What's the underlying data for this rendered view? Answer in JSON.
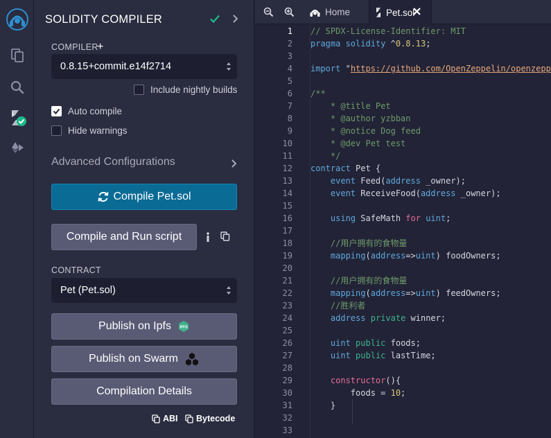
{
  "panel": {
    "title": "SOLIDITY COMPILER",
    "compiler_label": "COMPILER",
    "compiler_add": "+",
    "compiler_version": "0.8.15+commit.e14f2714",
    "include_nightly": "Include nightly builds",
    "auto_compile": "Auto compile",
    "hide_warnings": "Hide warnings",
    "advanced": "Advanced Configurations",
    "compile_button": "Compile Pet.sol",
    "compile_run_button": "Compile and Run script",
    "contract_label": "CONTRACT",
    "contract_value": "Pet (Pet.sol)",
    "publish_ipfs": "Publish on Ipfs",
    "ipfs_badge": "IPFS",
    "publish_swarm": "Publish on Swarm",
    "compilation_details": "Compilation Details",
    "abi": "ABI",
    "bytecode": "Bytecode",
    "checkbox_state": {
      "include_nightly": false,
      "auto_compile": true,
      "hide_warnings": false
    }
  },
  "icons": {
    "rail": [
      "remix-logo-icon",
      "file-explorer-icon",
      "search-icon",
      "solidity-compiler-icon",
      "deploy-run-icon"
    ],
    "accent": "#1bb98b",
    "primary_button": "#0a6b95"
  },
  "editor": {
    "tabs": [
      {
        "label": "Home",
        "icon": "home-icon"
      },
      {
        "label": "Pet.sol",
        "icon": "solidity-file-icon"
      }
    ],
    "active_line": 1,
    "lines": [
      [
        [
          "comment",
          "// SPDX-License-Identifier: MIT"
        ]
      ],
      [
        [
          "kw",
          "pragma solidity"
        ],
        [
          "plain",
          " ^"
        ],
        [
          "num",
          "0.8.13"
        ],
        [
          "plain",
          ";"
        ]
      ],
      [],
      [
        [
          "kw",
          "import"
        ],
        [
          "plain",
          " \""
        ],
        [
          "str",
          "https://github.com/OpenZeppelin/openzeppelin"
        ]
      ],
      [],
      [
        [
          "comment",
          "/**"
        ]
      ],
      [
        [
          "comment",
          "    * @title Pet"
        ]
      ],
      [
        [
          "comment",
          "    * @author yzbban"
        ]
      ],
      [
        [
          "comment",
          "    * @notice Dog feed"
        ]
      ],
      [
        [
          "comment",
          "    * @dev Pet test"
        ]
      ],
      [
        [
          "comment",
          "    */"
        ]
      ],
      [
        [
          "kw",
          "contract"
        ],
        [
          "plain",
          " Pet {"
        ]
      ],
      [
        [
          "plain",
          "    "
        ],
        [
          "kw",
          "event"
        ],
        [
          "plain",
          " Feed("
        ],
        [
          "kw",
          "address"
        ],
        [
          "plain",
          " _owner);"
        ]
      ],
      [
        [
          "plain",
          "    "
        ],
        [
          "kw",
          "event"
        ],
        [
          "plain",
          " ReceiveFood("
        ],
        [
          "kw",
          "address"
        ],
        [
          "plain",
          " _owner);"
        ]
      ],
      [],
      [
        [
          "plain",
          "    "
        ],
        [
          "kw",
          "using"
        ],
        [
          "plain",
          " SafeMath "
        ],
        [
          "ctor",
          "for"
        ],
        [
          "plain",
          " "
        ],
        [
          "kw",
          "uint"
        ],
        [
          "plain",
          ";"
        ]
      ],
      [],
      [
        [
          "comment",
          "    //用户拥有的食物量"
        ]
      ],
      [
        [
          "plain",
          "    "
        ],
        [
          "kw",
          "mapping"
        ],
        [
          "plain",
          "("
        ],
        [
          "kw",
          "address"
        ],
        [
          "plain",
          "=>"
        ],
        [
          "kw",
          "uint"
        ],
        [
          "plain",
          ") foodOwners;"
        ]
      ],
      [],
      [
        [
          "comment",
          "    //用户拥有的食物量"
        ]
      ],
      [
        [
          "plain",
          "    "
        ],
        [
          "kw",
          "mapping"
        ],
        [
          "plain",
          "("
        ],
        [
          "kw",
          "address"
        ],
        [
          "plain",
          "=>"
        ],
        [
          "kw",
          "uint"
        ],
        [
          "plain",
          ") feedOwners;"
        ]
      ],
      [
        [
          "comment",
          "    //胜利者"
        ]
      ],
      [
        [
          "plain",
          "    "
        ],
        [
          "kw",
          "address"
        ],
        [
          "plain",
          " "
        ],
        [
          "mod",
          "private"
        ],
        [
          "plain",
          " winner;"
        ]
      ],
      [],
      [
        [
          "plain",
          "    "
        ],
        [
          "kw",
          "uint"
        ],
        [
          "plain",
          " "
        ],
        [
          "mod",
          "public"
        ],
        [
          "plain",
          " foods;"
        ]
      ],
      [
        [
          "plain",
          "    "
        ],
        [
          "kw",
          "uint"
        ],
        [
          "plain",
          " "
        ],
        [
          "mod",
          "public"
        ],
        [
          "plain",
          " lastTime;"
        ]
      ],
      [],
      [
        [
          "plain",
          "    "
        ],
        [
          "ctor",
          "constructor"
        ],
        [
          "plain",
          "(){"
        ]
      ],
      [
        [
          "plain",
          "        foods = "
        ],
        [
          "num",
          "10"
        ],
        [
          "plain",
          ";"
        ]
      ],
      [
        [
          "plain",
          "    }"
        ]
      ],
      [],
      []
    ]
  }
}
